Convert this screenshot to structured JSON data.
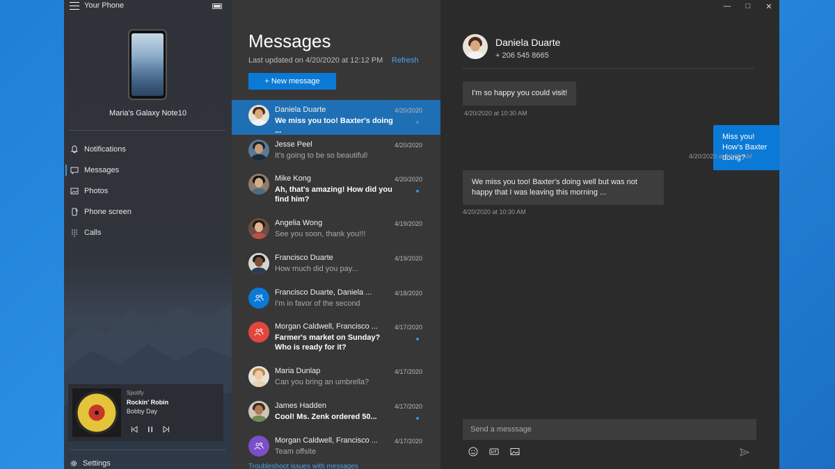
{
  "app": {
    "title": "Your Phone",
    "device_name": "Maria's Galaxy Note10"
  },
  "nav": {
    "items": [
      {
        "label": "Notifications",
        "icon": "bell-icon"
      },
      {
        "label": "Messages",
        "icon": "message-icon",
        "active": true
      },
      {
        "label": "Photos",
        "icon": "photo-icon"
      },
      {
        "label": "Phone screen",
        "icon": "phone-screen-icon"
      },
      {
        "label": "Calls",
        "icon": "dialpad-icon"
      }
    ],
    "settings_label": "Settings"
  },
  "media": {
    "app": "Spotify",
    "track": "Rockin' Robin",
    "artist": "Bobby Day"
  },
  "messages": {
    "title": "Messages",
    "last_updated": "Last updated on 4/20/2020 at 12:12 PM",
    "refresh_label": "Refresh",
    "new_message_label": "+ New message",
    "troubleshoot_label": "Troubleshoot issues with messages",
    "conversations": [
      {
        "name": "Daniela Duarte",
        "date": "4/20/2020",
        "preview": "We miss you too! Baxter's doing ...",
        "unread": true,
        "active": true
      },
      {
        "name": "Jesse Peel",
        "date": "4/20/2020",
        "preview": "It's going to be so beautiful!",
        "unread": false
      },
      {
        "name": "Mike Kong",
        "date": "4/20/2020",
        "preview": "Ah, that's amazing! How did you find him?",
        "unread": true
      },
      {
        "name": "Angelia Wong",
        "date": "4/19/2020",
        "preview": "See you soon, thank you!!!",
        "unread": false
      },
      {
        "name": "Francisco Duarte",
        "date": "4/19/2020",
        "preview": "How much did you pay...",
        "unread": false
      },
      {
        "name": "Francisco Duarte, Daniela ...",
        "date": "4/18/2020",
        "preview": "I'm in favor of the second",
        "unread": false
      },
      {
        "name": "Morgan Caldwell, Francisco ...",
        "date": "4/17/2020",
        "preview": "Farmer's market on Sunday? Who is ready for it?",
        "unread": true
      },
      {
        "name": "Maria Dunlap",
        "date": "4/17/2020",
        "preview": "Can you bring an umbrella?",
        "unread": false
      },
      {
        "name": "James Hadden",
        "date": "4/17/2020",
        "preview": "Cool! Ms. Zenk ordered 50...",
        "unread": true
      },
      {
        "name": "Morgan Caldwell, Francisco ...",
        "date": "4/17/2020",
        "preview": "Team offsite",
        "unread": false
      }
    ]
  },
  "thread": {
    "contact_name": "Daniela Duarte",
    "contact_phone": "+ 206 545 8665",
    "messages": [
      {
        "text": "I'm so happy you could visit!",
        "time": "4/20/2020 at 10:30 AM",
        "direction": "in"
      },
      {
        "text": "Miss you! How's Baxter doing?",
        "time": "4/20/2020 at 10:30 AM",
        "direction": "out"
      },
      {
        "text": "We miss you too! Baxter's doing well but was not happy that I was leaving this morning ...",
        "time": "4/20/2020 at 10:30 AM",
        "direction": "in"
      }
    ],
    "compose_placeholder": "Send a messsage"
  },
  "colors": {
    "accent": "#0b79d6",
    "selected_row": "#1f6fb5",
    "link": "#4aa3f0"
  }
}
